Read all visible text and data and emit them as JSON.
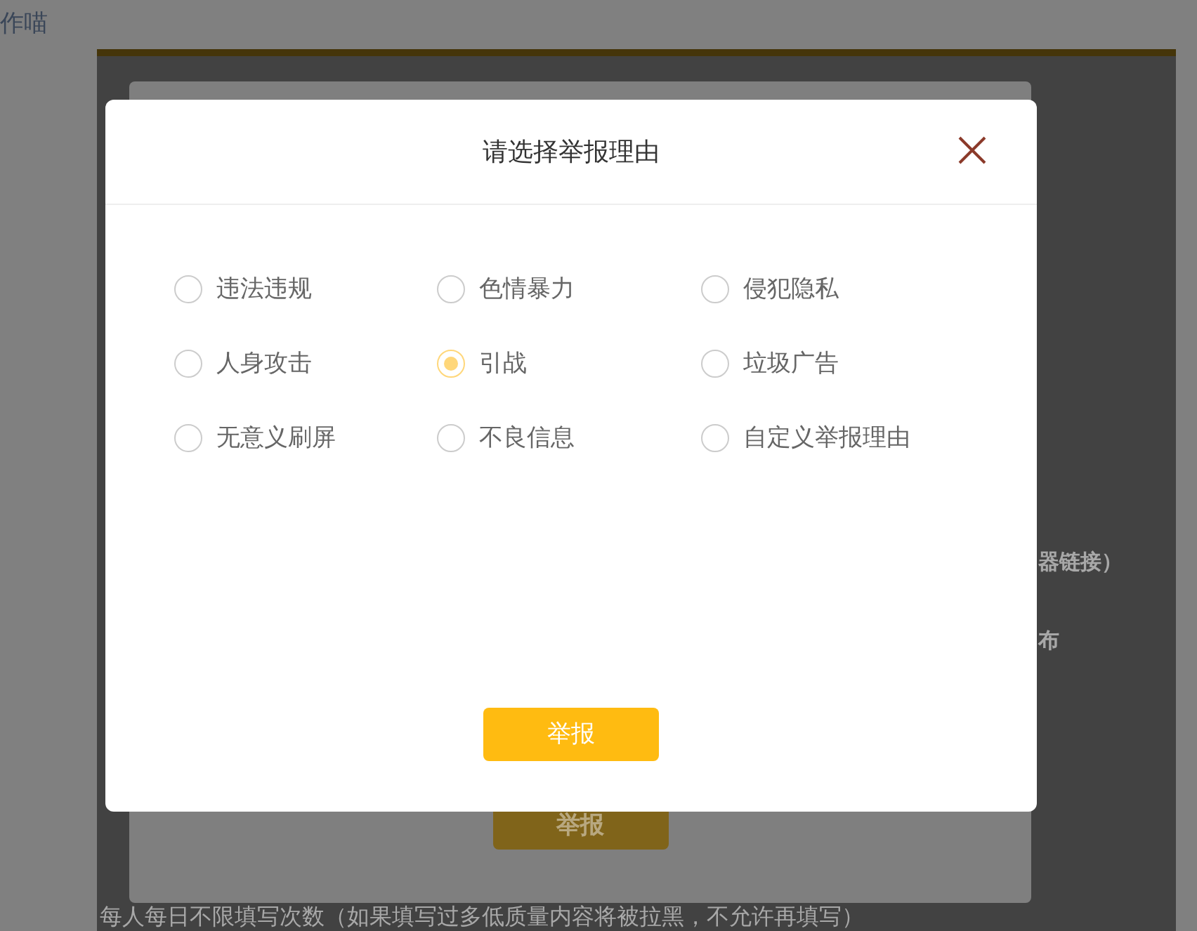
{
  "page": {
    "site_name": "作喵",
    "side_texts": [
      "器链接）",
      "布"
    ],
    "background_button": "举报",
    "footer_note": "每人每日不限填写次数（如果填写过多低质量内容将被拉黑，不允许再填写）"
  },
  "dialog": {
    "title": "请选择举报理由",
    "options": [
      {
        "label": "违法违规",
        "selected": false
      },
      {
        "label": "色情暴力",
        "selected": false
      },
      {
        "label": "侵犯隐私",
        "selected": false
      },
      {
        "label": "人身攻击",
        "selected": false
      },
      {
        "label": "引战",
        "selected": true
      },
      {
        "label": "垃圾广告",
        "selected": false
      },
      {
        "label": "无意义刷屏",
        "selected": false
      },
      {
        "label": "不良信息",
        "selected": false
      },
      {
        "label": "自定义举报理由",
        "selected": false
      }
    ],
    "submit": "举报"
  }
}
